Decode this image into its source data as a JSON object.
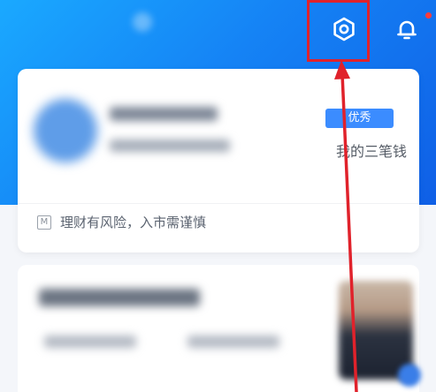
{
  "header": {
    "settings_icon": "gear-icon",
    "notification_icon": "bell-icon",
    "has_unread": true
  },
  "profile_card": {
    "badge_label": "优秀",
    "badge_caption": "我的三笔钱",
    "risk_icon": "M",
    "risk_notice": "理财有风险，入市需谨慎"
  },
  "colors": {
    "header_blue": "#1583f5",
    "badge_blue": "#3b8cff",
    "annotation_red": "#e0222b",
    "notification_dot": "#ff3b3b"
  }
}
